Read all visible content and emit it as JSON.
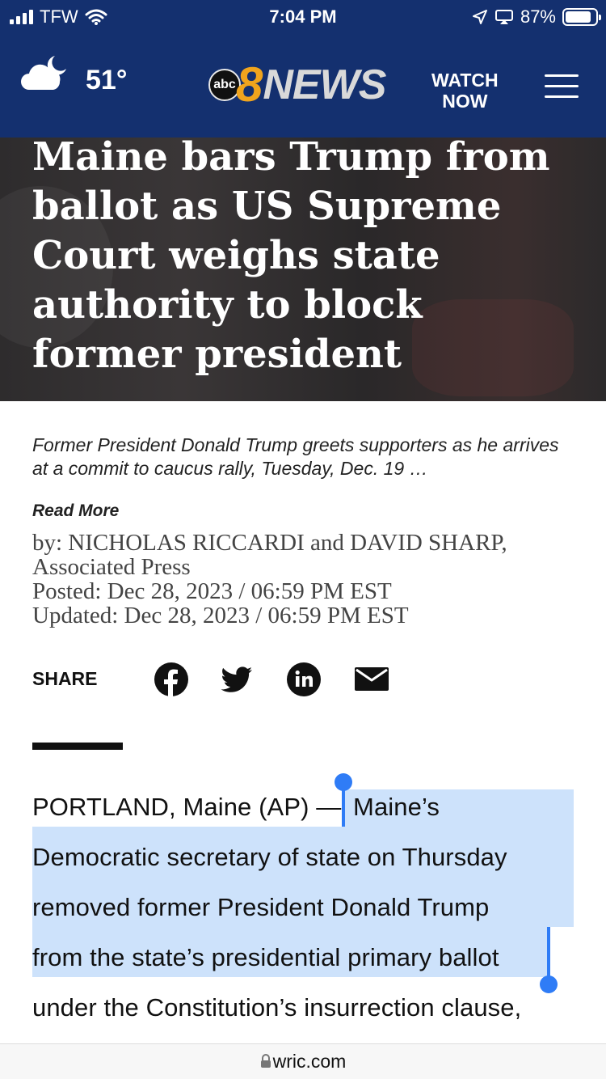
{
  "status_bar": {
    "carrier": "TFW",
    "time": "7:04 PM",
    "battery": "87%",
    "battery_level": 0.87
  },
  "header": {
    "weather_icon": "cloudy-night-icon",
    "temperature": "51°",
    "logo_abc": "abc",
    "logo_number": "8",
    "logo_news": "NEWS",
    "watch_line1": "WATCH",
    "watch_line2": "NOW",
    "menu_icon": "hamburger-menu-icon",
    "brand_color": "#14306f"
  },
  "article": {
    "headline": "Maine bars Trump from ballot as US Supreme Court weighs state authority to block former president",
    "caption": "Former President Donald Trump greets supporters as he arrives at a commit to caucus rally, Tuesday, Dec. 19 …",
    "read_more": "Read More",
    "byline_1": "by: NICHOLAS RICCARDI and DAVID SHARP,",
    "byline_2": "Associated Press",
    "posted": "Posted: Dec 28, 2023 / 06:59 PM EST",
    "updated": "Updated: Dec 28, 2023 / 06:59 PM EST"
  },
  "share": {
    "label": "SHARE",
    "icons": [
      "facebook-icon",
      "twitter-icon",
      "linkedin-icon",
      "email-icon"
    ]
  },
  "body": {
    "line1_prefix": "PORTLAND, Maine (AP) — ",
    "line1_selected": "Maine’s",
    "line2": "Democratic secretary of state on Thursday",
    "line3": "removed former President Donald Trump",
    "line4": "from the state’s presidential primary ballot",
    "line5": "under the Constitution’s insurrection clause,",
    "selection_color": "#cde2fb"
  },
  "url_bar": {
    "url": "wric.com",
    "lock_icon": "lock-icon"
  }
}
